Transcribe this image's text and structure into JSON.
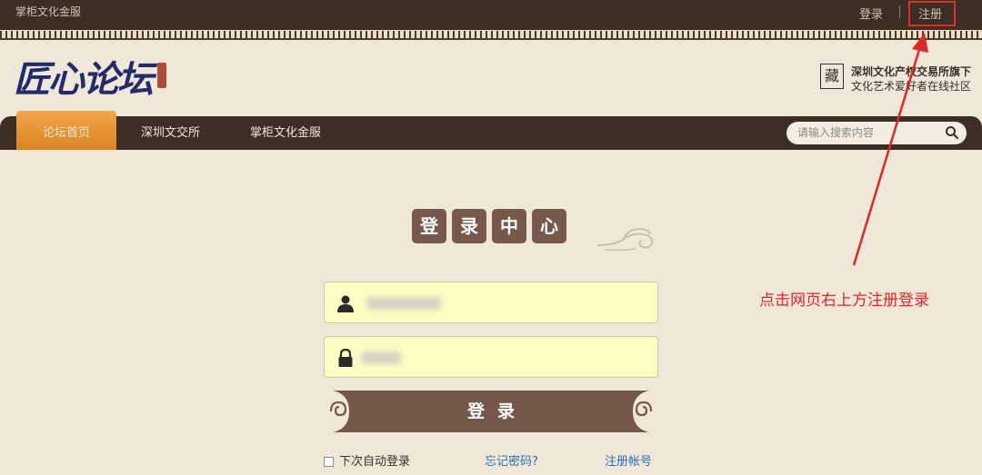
{
  "topbar": {
    "site_name": "掌柜文化金服",
    "login": "登录",
    "register": "注册"
  },
  "header": {
    "logo_text": "匠心论坛",
    "sponsor_badge": "藏",
    "sponsor_line1": "深圳文化产权交易所旗下",
    "sponsor_line2": "文化艺术爱好者在线社区"
  },
  "nav": {
    "items": [
      {
        "label": "论坛首页",
        "active": true
      },
      {
        "label": "深圳文交所"
      },
      {
        "label": "掌柜文化金服"
      }
    ],
    "search_placeholder": "请输入搜索内容",
    "search_icon": "search-icon"
  },
  "login_panel": {
    "title_chars": [
      "登",
      "录",
      "中",
      "心"
    ],
    "username_icon": "user-icon",
    "password_icon": "lock-icon",
    "login_button": "登录",
    "remember_me": "下次自动登录",
    "forgot_password": "忘记密码?",
    "register_account": "注册帐号"
  },
  "annotation": {
    "text": "点击网页右上方注册登录",
    "color": "#e02626"
  },
  "colors": {
    "dark_brown": "#3d2e24",
    "accent_orange": "#f3a64a",
    "tile_brown": "#76594a",
    "field_yellow": "#fefcc2",
    "link_blue": "#2c6fb5"
  }
}
